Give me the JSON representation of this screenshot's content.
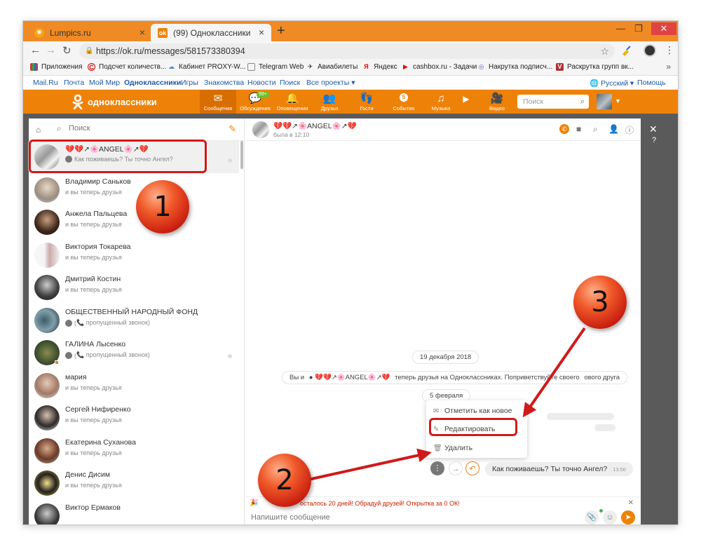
{
  "browser": {
    "tabs": [
      {
        "title": "Lumpics.ru"
      },
      {
        "title": "(99) Одноклассники"
      }
    ],
    "url": "https://ok.ru/messages/581573380394",
    "bookmarks": [
      "Приложения",
      "Подсчет количеств...",
      "Кабинет PROXY-W...",
      "Telegram Web",
      "Авиабилеты",
      "Яндекс",
      "cashbox.ru - Задачи",
      "Накрутка подписч...",
      "Раскрутка групп вк..."
    ]
  },
  "portal": {
    "links": [
      "Mail.Ru",
      "Почта",
      "Мой Мир",
      "Одноклассники",
      "Игры",
      "Знакомства",
      "Новости",
      "Поиск",
      "Все проекты ▾"
    ],
    "language": "Русский ▾",
    "help": "Помощь"
  },
  "ok": {
    "logo": "одноклассники",
    "nav": [
      {
        "label": "Сообщения",
        "icon": "envelope-icon"
      },
      {
        "label": "Обсуждения",
        "icon": "chat-icon",
        "badge": "99+"
      },
      {
        "label": "Оповещения",
        "icon": "bell-icon"
      },
      {
        "label": "Друзья",
        "icon": "friends-icon"
      },
      {
        "label": "Гости",
        "icon": "footprints-icon"
      },
      {
        "label": "События",
        "icon": "events-icon",
        "badge": "5"
      },
      {
        "label": "Музыка",
        "icon": "music-icon"
      },
      {
        "label": "Видео",
        "icon": "video-icon"
      }
    ],
    "search_placeholder": "Поиск"
  },
  "conversations": {
    "search_placeholder": "Поиск",
    "items": [
      {
        "name": "💔💔↗🌸ANGEL🌸↗💔",
        "last": "Как поживаешь? Ты точно Ангел?"
      },
      {
        "name": "Владимир Саньков",
        "last": "и вы теперь друзья"
      },
      {
        "name": "Анжела Пальцева",
        "last": "и вы теперь друзья"
      },
      {
        "name": "Виктория Токарева",
        "last": "и вы теперь друзья"
      },
      {
        "name": "Дмитрий Костин",
        "last": "и вы теперь друзья"
      },
      {
        "name": "ОБЩЕСТВЕННЫЙ НАРОДНЫЙ ФОНД",
        "last": "📞 пропущенный звонок)"
      },
      {
        "name": "ГАЛИНА Лысенко",
        "last": "📞 пропущенный звонок)"
      },
      {
        "name": "мария",
        "last": "и вы теперь друзья"
      },
      {
        "name": "Сергей Нифиренко",
        "last": "и вы теперь друзья"
      },
      {
        "name": "Екатерина Суханова",
        "last": "и вы теперь друзья"
      },
      {
        "name": "Денис Дисим",
        "last": "и вы теперь друзья"
      },
      {
        "name": "Виктор Ермаков",
        "last": ""
      }
    ]
  },
  "chat": {
    "name": "💔💔↗🌸ANGEL🌸↗💔",
    "status": "была в 12:10",
    "date1": "19 декабря 2018",
    "system_prefix": "Вы и",
    "system_name": "💔💔↗🌸ANGEL🌸↗💔",
    "system_suffix": "теперь друзья на Одноклассниках. Поприветствуйте своего",
    "system_tail": "ового друга",
    "date2": "5 февраля",
    "menu": {
      "mark_new": "Отметить как новое",
      "edit": "Редактировать",
      "delete": "Удалить"
    },
    "message": {
      "text": "Как поживаешь? Ты точно Ангел?",
      "time": "13:56"
    },
    "promo": "осталось 20 дней! Обрадуй друзей! Открытка за 0 ОК!",
    "composer_placeholder": "Напишите сообщение"
  },
  "annotations": [
    "1",
    "2",
    "3"
  ],
  "colors": {
    "ok_orange": "#ee8208",
    "callout_red": "#d01a1a"
  }
}
